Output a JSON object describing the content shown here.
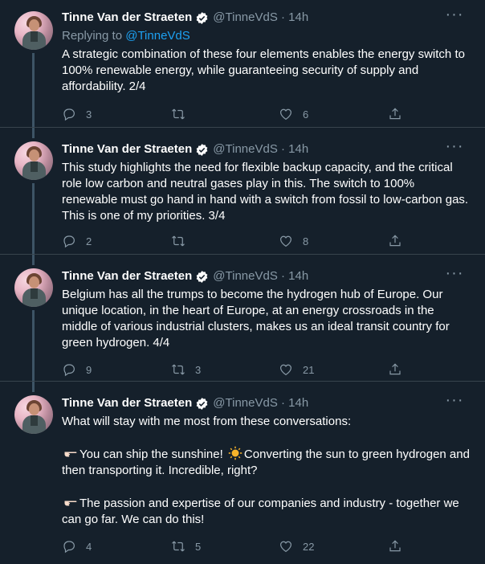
{
  "tweets": [
    {
      "name": "Tinne Van der Straeten",
      "handle": "@TinneVdS · 14h",
      "replying_prefix": "Replying to ",
      "replying_to": "@TinneVdS",
      "text": "A strategic combination of these four elements enables the energy switch to 100% renewable energy, while guaranteeing security of supply and affordability. 2/4",
      "replies": "3",
      "retweets": "",
      "likes": "6"
    },
    {
      "name": "Tinne Van der Straeten",
      "handle": "@TinneVdS · 14h",
      "text": "This study highlights the need for flexible backup capacity, and the critical role low carbon and neutral gases play in this. The switch to 100% renewable must go hand in hand with a switch from fossil to low-carbon gas. This is one of my priorities. 3/4",
      "replies": "2",
      "retweets": "",
      "likes": "8"
    },
    {
      "name": "Tinne Van der Straeten",
      "handle": "@TinneVdS · 14h",
      "text": "Belgium has all the trumps to become the hydrogen hub of Europe. Our unique location, in the heart of Europe, at an energy crossroads in the middle of various industrial clusters, makes us an ideal transit country for green hydrogen. 4/4",
      "replies": "9",
      "retweets": "3",
      "likes": "21"
    },
    {
      "name": "Tinne Van der Straeten",
      "handle": "@TinneVdS · 14h",
      "text_line1": "What will stay with me most from these conversations:",
      "para1_a": "You can ship the sunshine! ",
      "para1_b": "Converting the sun to green hydrogen and then transporting it. Incredible, right?",
      "para2": "The passion and expertise of our companies and industry - together we can go far. We can do this!",
      "replies": "4",
      "retweets": "5",
      "likes": "22"
    }
  ],
  "icons": {
    "more": "more-icon",
    "reply": "reply-icon",
    "retweet": "retweet-icon",
    "like": "heart-icon",
    "share": "share-icon",
    "verified": "verified-badge-icon"
  },
  "colors": {
    "background": "#15202b",
    "secondary_text": "#8899a6",
    "link": "#1da1f2",
    "divider": "#38444d",
    "thread_line": "#3d5466"
  }
}
